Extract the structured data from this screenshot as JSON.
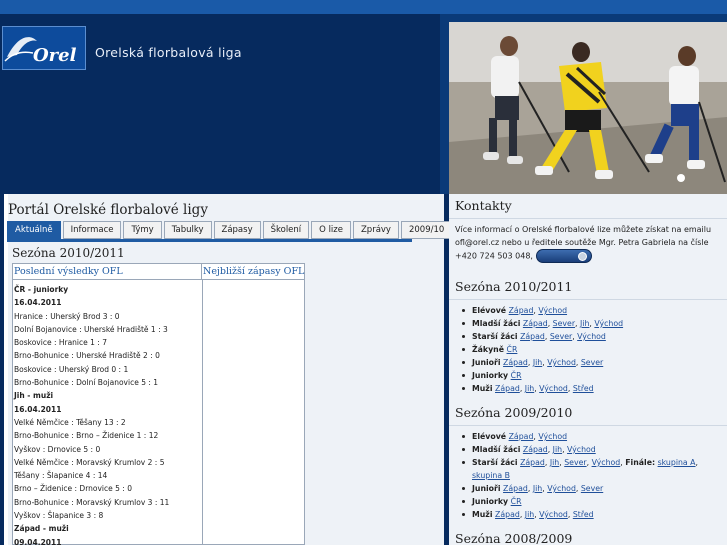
{
  "header": {
    "title": "Orelská florbalová liga",
    "logo_text": "Orel"
  },
  "main": {
    "portal_title": "Portál Orelské florbalové ligy",
    "tabs": [
      {
        "label": "Aktuálně",
        "active": true
      },
      {
        "label": "Informace"
      },
      {
        "label": "Týmy"
      },
      {
        "label": "Tabulky"
      },
      {
        "label": "Zápasy"
      },
      {
        "label": "Školení"
      },
      {
        "label": "O lize"
      },
      {
        "label": "Zprávy"
      },
      {
        "label": "2009/10"
      }
    ],
    "season_title": "Sezóna 2010/2011",
    "results_head": "Poslední výsledky OFL",
    "upcoming_head": "Nejbližší zápasy OFL",
    "rows": [
      {
        "text": "ČR - juniorky",
        "bold": true
      },
      {
        "text": "16.04.2011",
        "bold": true
      },
      {
        "text": "Hranice : Uherský Brod 3 : 0"
      },
      {
        "text": "Dolní Bojanovice : Uherské Hradiště 1 : 3"
      },
      {
        "text": "Boskovice : Hranice 1 : 7"
      },
      {
        "text": "Brno-Bohunice : Uherské Hradiště 2 : 0"
      },
      {
        "text": "Boskovice : Uherský Brod 0 : 1"
      },
      {
        "text": "Brno-Bohunice : Dolní Bojanovice 5 : 1"
      },
      {
        "text": "Jih - muži",
        "bold": true
      },
      {
        "text": "16.04.2011",
        "bold": true
      },
      {
        "text": "Velké Němčice : Těšany 13 : 2"
      },
      {
        "text": "Brno-Bohunice : Brno – Židenice 1 : 12"
      },
      {
        "text": "Vyškov : Drnovice 5 : 0"
      },
      {
        "text": "Velké Němčice : Moravský Krumlov 2 : 5"
      },
      {
        "text": "Těšany : Šlapanice 4 : 14"
      },
      {
        "text": "Brno – Židenice : Drnovice 5 : 0"
      },
      {
        "text": "Brno-Bohunice : Moravský Krumlov 3 : 11"
      },
      {
        "text": "Vyškov : Šlapanice 3 : 8"
      },
      {
        "text": "Západ - muži",
        "bold": true
      },
      {
        "text": "09.04.2011",
        "bold": true
      }
    ]
  },
  "sidebar": {
    "contacts_title": "Kontakty",
    "contact_text": "Více informací o Orelské florbalové lize můžete získat na emailu ofl@orel.cz nebo u ředitele soutěže Mgr. Petra Gabriela na čísle +420 724 503 048,",
    "season_2011_title": "Sezóna 2010/2011",
    "season_2011_items": [
      {
        "cat": "Elévové",
        "links": [
          "Západ",
          "Východ"
        ]
      },
      {
        "cat": "Mladší žáci",
        "links": [
          "Západ",
          "Sever",
          "Jih",
          "Východ"
        ]
      },
      {
        "cat": "Starší žáci",
        "links": [
          "Západ",
          "Sever",
          "Východ"
        ]
      },
      {
        "cat": "Žákyně",
        "links": [
          "ČR"
        ]
      },
      {
        "cat": "Junioři",
        "links": [
          "Západ",
          "Jih",
          "Východ",
          "Sever"
        ]
      },
      {
        "cat": "Juniorky",
        "links": [
          "ČR"
        ]
      },
      {
        "cat": "Muži",
        "links": [
          "Západ",
          "Jih",
          "Východ",
          "Střed"
        ]
      }
    ],
    "season_2010_title": "Sezóna 2009/2010",
    "season_2010_items": [
      {
        "cat": "Elévové",
        "links": [
          "Západ",
          "Východ"
        ]
      },
      {
        "cat": "Mladší žáci",
        "links": [
          "Západ",
          "Jih",
          "Východ"
        ]
      },
      {
        "cat": "Starší žáci",
        "links": [
          "Západ",
          "Jih",
          "Sever",
          "Východ"
        ],
        "extra_label": "Finále:",
        "extra_links": [
          "skupina A",
          "skupina B"
        ]
      },
      {
        "cat": "Junioři",
        "links": [
          "Západ",
          "Jih",
          "Východ",
          "Sever"
        ]
      },
      {
        "cat": "Juniorky",
        "links": [
          "ČR"
        ]
      },
      {
        "cat": "Muži",
        "links": [
          "Západ",
          "Jih",
          "Východ",
          "Střed"
        ]
      }
    ],
    "season_2009_title": "Sezóna 2008/2009"
  },
  "colors": {
    "header_navy": "#062a5e",
    "tab_active": "#1f5ba3",
    "link": "#1f4f9a"
  }
}
